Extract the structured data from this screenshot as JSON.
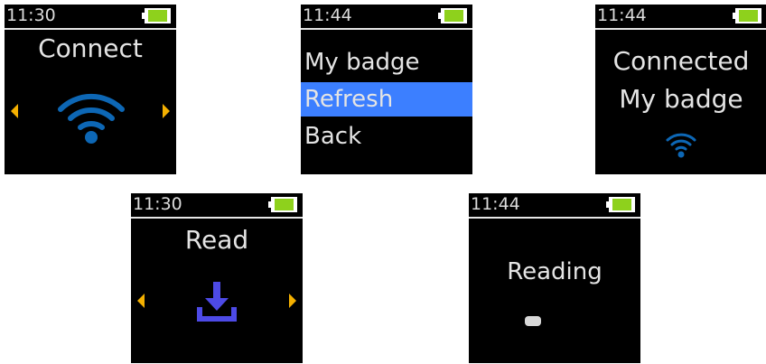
{
  "screens": {
    "connect": {
      "time": "11:30",
      "title": "Connect",
      "icon": "wifi-icon"
    },
    "menu": {
      "time": "11:44",
      "items": [
        {
          "label": "My badge",
          "selected": false
        },
        {
          "label": "Refresh",
          "selected": true
        },
        {
          "label": "Back",
          "selected": false
        }
      ]
    },
    "connected": {
      "time": "11:44",
      "line1": "Connected",
      "line2": "My badge",
      "icon": "wifi-icon"
    },
    "read": {
      "time": "11:30",
      "title": "Read",
      "icon": "download-icon"
    },
    "reading": {
      "time": "11:44",
      "title": "Reading",
      "icon": "progress-indicator"
    }
  },
  "colors": {
    "screen_bg": "#000000",
    "text": "#e4e4e4",
    "battery_fill": "#8ed11c",
    "arrow": "#f4b000",
    "wifi": "#0d67b5",
    "download": "#4d4ae6",
    "selection": "#3c7fff"
  }
}
